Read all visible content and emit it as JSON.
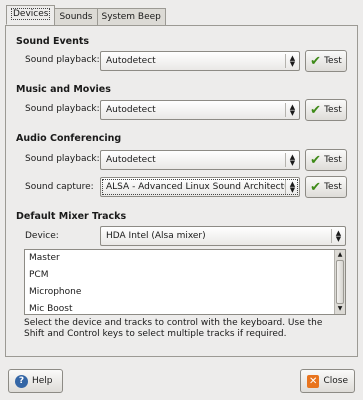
{
  "tabs": [
    {
      "label": "Devices"
    },
    {
      "label": "Sounds"
    },
    {
      "label": "System Beep"
    }
  ],
  "sound_events": {
    "title": "Sound Events",
    "playback_label": "Sound playback:",
    "playback_value": "Autodetect",
    "test_label": "Test"
  },
  "music_movies": {
    "title": "Music and Movies",
    "playback_label": "Sound playback:",
    "playback_value": "Autodetect",
    "test_label": "Test"
  },
  "audio_conf": {
    "title": "Audio Conferencing",
    "playback_label": "Sound playback:",
    "playback_value": "Autodetect",
    "capture_label": "Sound capture:",
    "capture_value": "ALSA - Advanced Linux Sound Architecture",
    "test_label": "Test"
  },
  "mixer": {
    "title": "Default Mixer Tracks",
    "device_label": "Device:",
    "device_value": "HDA Intel (Alsa mixer)",
    "tracks": [
      "Master",
      "PCM",
      "Microphone",
      "Mic Boost"
    ],
    "hint": "Select the device and tracks to control with the keyboard. Use the Shift and Control keys to select multiple tracks if required."
  },
  "footer": {
    "help_label": "Help",
    "close_label": "Close"
  }
}
